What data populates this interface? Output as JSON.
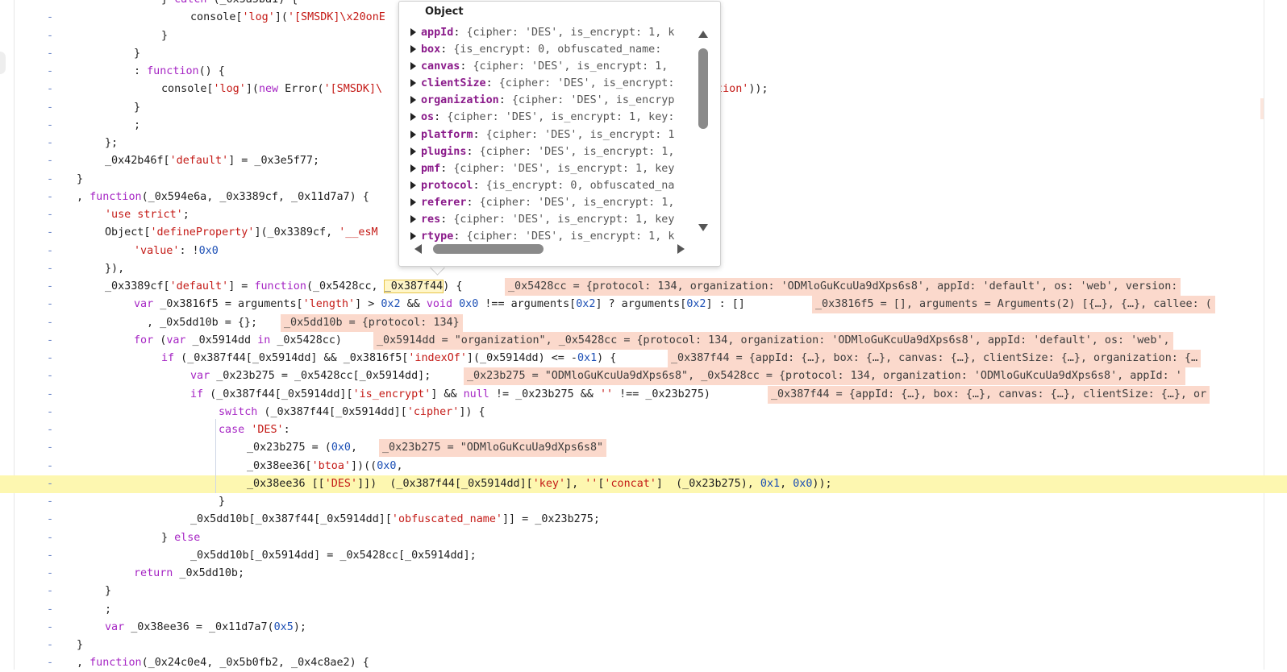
{
  "popover": {
    "title": "Object",
    "rows": [
      {
        "key": "appId",
        "value": "{cipher: 'DES', is_encrypt: 1, k"
      },
      {
        "key": "box",
        "value": "{is_encrypt: 0, obfuscated_name:"
      },
      {
        "key": "canvas",
        "value": "{cipher: 'DES', is_encrypt: 1,"
      },
      {
        "key": "clientSize",
        "value": "{cipher: 'DES', is_encrypt:"
      },
      {
        "key": "organization",
        "value": "{cipher: 'DES', is_encryp"
      },
      {
        "key": "os",
        "value": "{cipher: 'DES', is_encrypt: 1, key:"
      },
      {
        "key": "platform",
        "value": "{cipher: 'DES', is_encrypt: 1"
      },
      {
        "key": "plugins",
        "value": "{cipher: 'DES', is_encrypt: 1,"
      },
      {
        "key": "pmf",
        "value": "{cipher: 'DES', is_encrypt: 1, key"
      },
      {
        "key": "protocol",
        "value": "{is_encrypt: 0, obfuscated_na"
      },
      {
        "key": "referer",
        "value": "{cipher: 'DES', is_encrypt: 1,"
      },
      {
        "key": "res",
        "value": "{cipher: 'DES', is_encrypt: 1, key"
      },
      {
        "key": "rtype",
        "value": "{cipher: 'DES', is_encrypt: 1, k"
      }
    ]
  },
  "code": {
    "line_marker": "-",
    "lines": [
      {
        "indent": 200,
        "text": "} catch (_0x5a5ba1) {"
      },
      {
        "indent": 236,
        "text": "console['log']('[SMSDK]\\x20onE"
      },
      {
        "indent": 200,
        "text": "}"
      },
      {
        "indent": 166,
        "text": "}"
      },
      {
        "indent": 166,
        "text": ": function() {"
      },
      {
        "indent": 200,
        "text": "console['log'](new Error('[SMSDK]\\"
      },
      {
        "indent": 166,
        "text": "}"
      },
      {
        "indent": 166,
        "text": ";"
      },
      {
        "indent": 130,
        "text": "};"
      },
      {
        "indent": 130,
        "text": "_0x42b46f['default'] = _0x3e5f77;"
      },
      {
        "indent": 95,
        "text": "}"
      },
      {
        "indent": 95,
        "text": ", function(_0x594e6a, _0x3389cf, _0x11d7a7) {"
      },
      {
        "indent": 130,
        "text": "'use strict';"
      },
      {
        "indent": 130,
        "text": "Object['defineProperty'](_0x3389cf, '__esM"
      },
      {
        "indent": 166,
        "text": "'value': !0x0"
      },
      {
        "indent": 130,
        "text": "}),"
      },
      {
        "indent": 130,
        "text": "_0x3389cf['default'] = function(_0x5428cc, _0x387f44) {"
      },
      {
        "indent": 166,
        "text": "var _0x3816f5 = arguments['length'] > 0x2 && void 0x0 !== arguments[0x2] ? arguments[0x2] : []"
      },
      {
        "indent": 182,
        "text": ", _0x5dd10b = {};"
      },
      {
        "indent": 166,
        "text": "for (var _0x5914dd in _0x5428cc)"
      },
      {
        "indent": 200,
        "text": "if (_0x387f44[_0x5914dd] && _0x3816f5['indexOf'](_0x5914dd) <= -0x1) {"
      },
      {
        "indent": 236,
        "text": "var _0x23b275 = _0x5428cc[_0x5914dd];"
      },
      {
        "indent": 236,
        "text": "if (_0x387f44[_0x5914dd]['is_encrypt'] && null != _0x23b275 && '' !== _0x23b275)"
      },
      {
        "indent": 271,
        "text": "switch (_0x387f44[_0x5914dd]['cipher']) {"
      },
      {
        "indent": 271,
        "text": "case 'DES':"
      },
      {
        "indent": 306,
        "text": "_0x23b275 = (0x0,"
      },
      {
        "indent": 306,
        "text": "_0x38ee36['btoa'])((0x0,"
      },
      {
        "indent": 306,
        "text": "_0x38ee36 [['DES']])  (_0x387f44[_0x5914dd]['key'], ''['concat']  (_0x23b275), 0x1, 0x0));"
      },
      {
        "indent": 271,
        "text": "}"
      },
      {
        "indent": 236,
        "text": "_0x5dd10b[_0x387f44[_0x5914dd]['obfuscated_name']] = _0x23b275;"
      },
      {
        "indent": 200,
        "text": "} else"
      },
      {
        "indent": 236,
        "text": "_0x5dd10b[_0x5914dd] = _0x5428cc[_0x5914dd];"
      },
      {
        "indent": 166,
        "text": "return _0x5dd10b;"
      },
      {
        "indent": 130,
        "text": "}"
      },
      {
        "indent": 130,
        "text": ";"
      },
      {
        "indent": 130,
        "text": "var _0x38ee36 = _0x11d7a7(0x5);"
      },
      {
        "indent": 95,
        "text": "}"
      },
      {
        "indent": 95,
        "text": ", function(_0x24c0e4, _0x5b0fb2, _0x4c8ae2) {"
      }
    ],
    "fragment_after_popover_line5": "ation'));",
    "inline_values": {
      "l16": "_0x5428cc = {protocol: 134, organization: 'ODMloGuKcuUa9dXps6s8', appId: 'default', os: 'web', version:",
      "l17": "_0x3816f5 = [], arguments = Arguments(2) [{…}, {…}, callee: (",
      "l18": "_0x5dd10b = {protocol: 134}",
      "l19": "_0x5914dd = \"organization\", _0x5428cc = {protocol: 134, organization: 'ODMloGuKcuUa9dXps6s8', appId: 'default', os: 'web',",
      "l20": "_0x387f44 = {appId: {…}, box: {…}, canvas: {…}, clientSize: {…}, organization: {…",
      "l21": "_0x23b275 = \"ODMloGuKcuUa9dXps6s8\", _0x5428cc = {protocol: 134, organization: 'ODMloGuKcuUa9dXps6s8', appId: '",
      "l22": "_0x387f44 = {appId: {…}, box: {…}, canvas: {…}, clientSize: {…}, or",
      "l25": "_0x23b275 = \"ODMloGuKcuUa9dXps6s8\""
    },
    "hovered_token": "_0x387f44"
  }
}
